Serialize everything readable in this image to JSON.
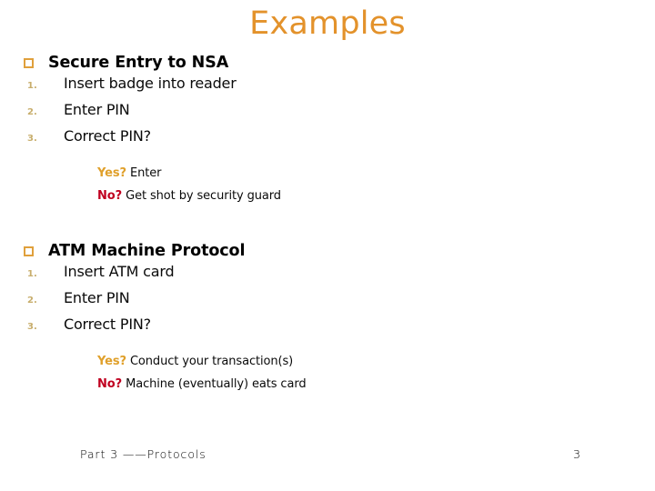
{
  "slide": {
    "title": "Examples",
    "title_color": "#E3922B",
    "bullet_color": "#E0A03C",
    "marker_color": "#C8AE6D",
    "yes_color": "#E0A02B",
    "no_color": "#C00020",
    "sections": [
      {
        "heading": "Secure Entry to NSA",
        "bullet_icon": "hollow-square-bullet",
        "items": [
          {
            "marker": "1.",
            "text": "Insert badge into reader"
          },
          {
            "marker": "2.",
            "text": "Enter PIN"
          },
          {
            "marker": "3.",
            "text": "Correct PIN?"
          }
        ],
        "branches": [
          {
            "lead": "Yes?",
            "text": " Enter"
          },
          {
            "lead": "No?",
            "text": " Get shot by security guard"
          }
        ]
      },
      {
        "heading": "ATM Machine Protocol",
        "bullet_icon": "hollow-square-bullet",
        "items": [
          {
            "marker": "1.",
            "text": "Insert ATM card"
          },
          {
            "marker": "2.",
            "text": "Enter PIN"
          },
          {
            "marker": "3.",
            "text": "Correct PIN?"
          }
        ],
        "branches": [
          {
            "lead": "Yes?",
            "text": " Conduct your transaction(s)"
          },
          {
            "lead": "No?",
            "text": " Machine (eventually) eats card"
          }
        ]
      }
    ]
  },
  "footer": {
    "left_text": "Part 3 ——Protocols",
    "page_number": "3"
  }
}
